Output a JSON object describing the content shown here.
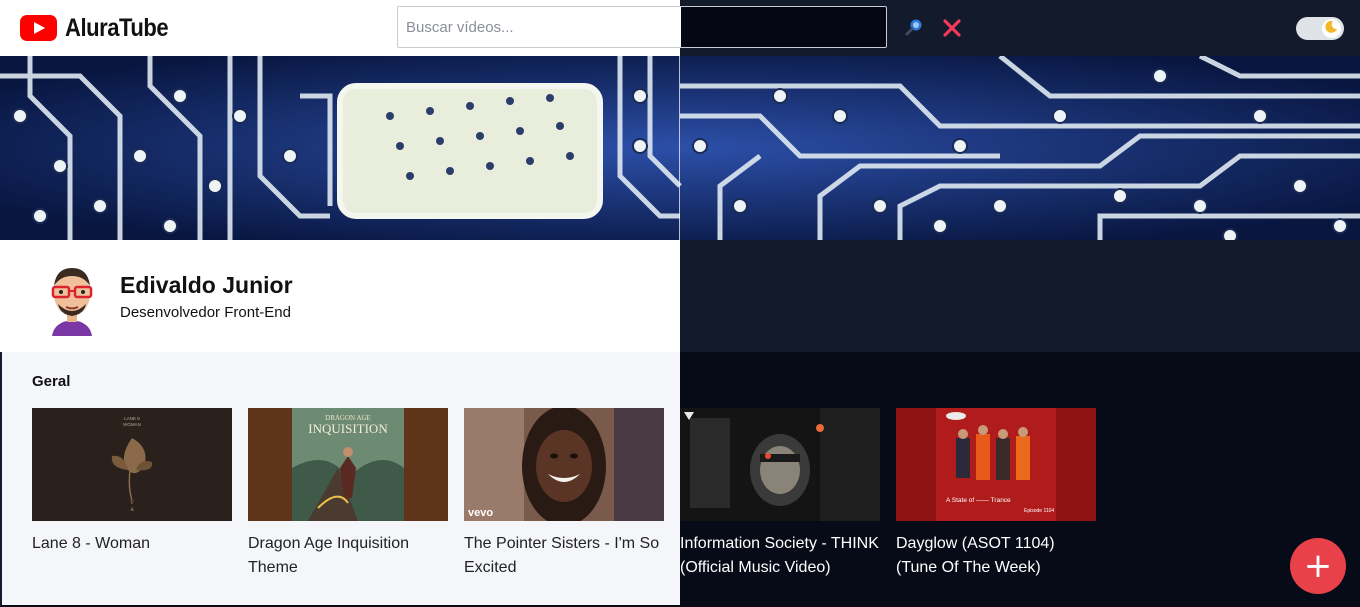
{
  "header": {
    "logo_text": "AluraTube",
    "search_placeholder": "Buscar vídeos...",
    "search_icon": "search-icon",
    "clear_icon": "close-icon",
    "theme_toggle_icon": "moon-icon"
  },
  "profile": {
    "name": "Edivaldo Junior",
    "role": "Desenvolvedor Front-End"
  },
  "playlist": {
    "title": "Geral",
    "videos": [
      {
        "title": "Lane 8 - Woman"
      },
      {
        "title": "Dragon Age Inquisition Theme"
      },
      {
        "title": "The Pointer Sisters - I'm So Excited"
      },
      {
        "title": "Information Society - THINK (Official Music Video)"
      },
      {
        "title": "Dayglow (ASOT 1104) (Tune Of The Week)"
      }
    ]
  },
  "thumbnails": {
    "t1": {
      "line1": "LANE 8",
      "line2": "WOMAN",
      "line3": "V",
      "line4": "A"
    },
    "t2": {
      "line1": "DRAGON AGE",
      "line2": "INQUISITION"
    },
    "t3": {
      "badge": "vevo"
    },
    "t5": {
      "caption": "A State of —— Trance",
      "episode": "Episode 1104"
    }
  },
  "fab": {
    "label": "+"
  },
  "colors": {
    "accent_red": "#e9414a",
    "youtube_red": "#ff0000",
    "dark_header": "#121a2c",
    "dark_bg": "#070a17",
    "light_bg": "#f4f6f9"
  }
}
